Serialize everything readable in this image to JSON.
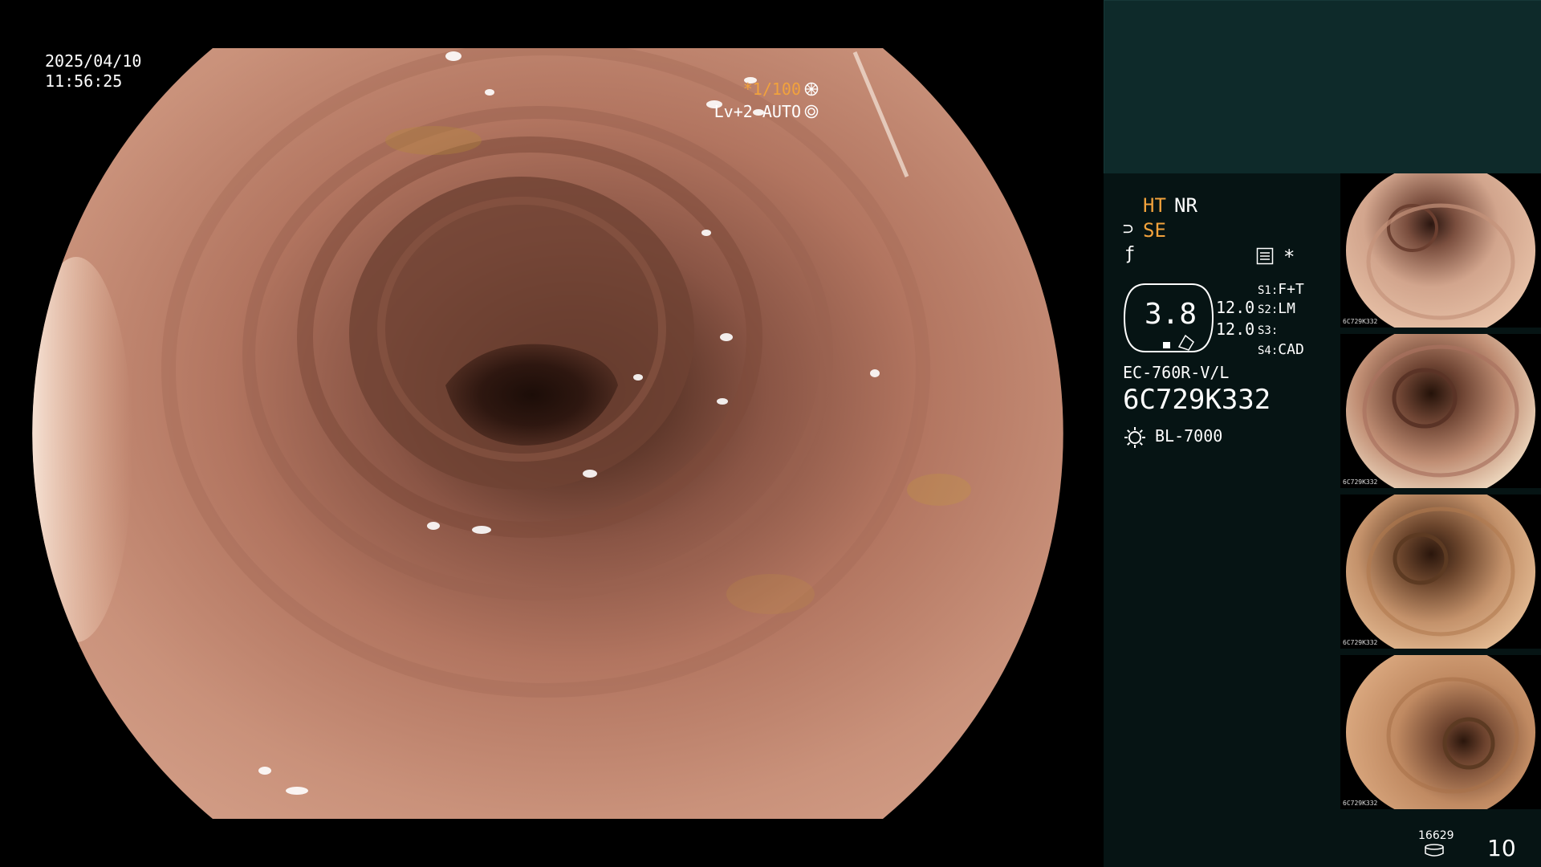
{
  "overlay": {
    "date": "2025/04/10",
    "time": "11:56:25",
    "shutter": "*1/100",
    "level": "Lv+2 AUTO"
  },
  "info": {
    "ht": "HT",
    "nr": "NR",
    "se": "SE",
    "zoom": "3.8",
    "val1": "12.0",
    "val2": "12.0",
    "s1_key": "S1:",
    "s1_val": "F+T",
    "s2_key": "S2:",
    "s2_val": "LM",
    "s3_key": "S3:",
    "s3_val": "",
    "s4_key": "S4:",
    "s4_val": "CAD",
    "model": "EC-760R-V/L",
    "serial": "6C729K332",
    "light": "BL-7000"
  },
  "footer": {
    "counter": "16629",
    "page": "10"
  },
  "thumbnails": [
    {
      "serial": "6C729K332"
    },
    {
      "serial": "6C729K332"
    },
    {
      "serial": "6C729K332"
    },
    {
      "serial": "6C729K332"
    }
  ],
  "colors": {
    "accent": "#f2a23c",
    "panel_bg": "#061414",
    "panel_top_bg": "#0e2a2a"
  },
  "icons": [
    "shutter-icon",
    "auto-iris-icon",
    "se-icon",
    "f-icon",
    "menu-icon",
    "star-icon",
    "light-icon",
    "disk-icon"
  ]
}
